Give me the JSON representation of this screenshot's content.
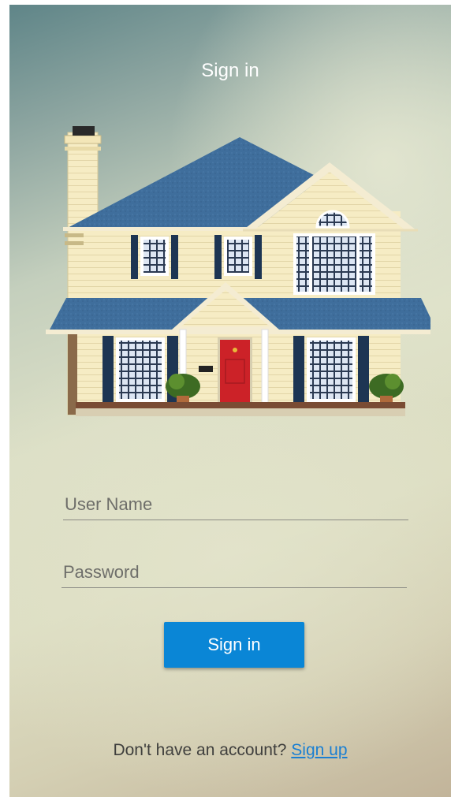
{
  "header": {
    "title": "Sign in"
  },
  "form": {
    "username_placeholder": "User Name",
    "username_value": "",
    "password_placeholder": "Password",
    "password_value": "",
    "submit_label": "Sign in"
  },
  "footer": {
    "prompt": "Don't have an account?",
    "signup_label": "Sign up"
  },
  "illustration": {
    "icon": "house-icon"
  },
  "colors": {
    "accent": "#0a86d6",
    "link": "#1a7fd2",
    "roof": "#3f6e9c",
    "siding": "#f6ecc4",
    "door": "#cc2228"
  }
}
